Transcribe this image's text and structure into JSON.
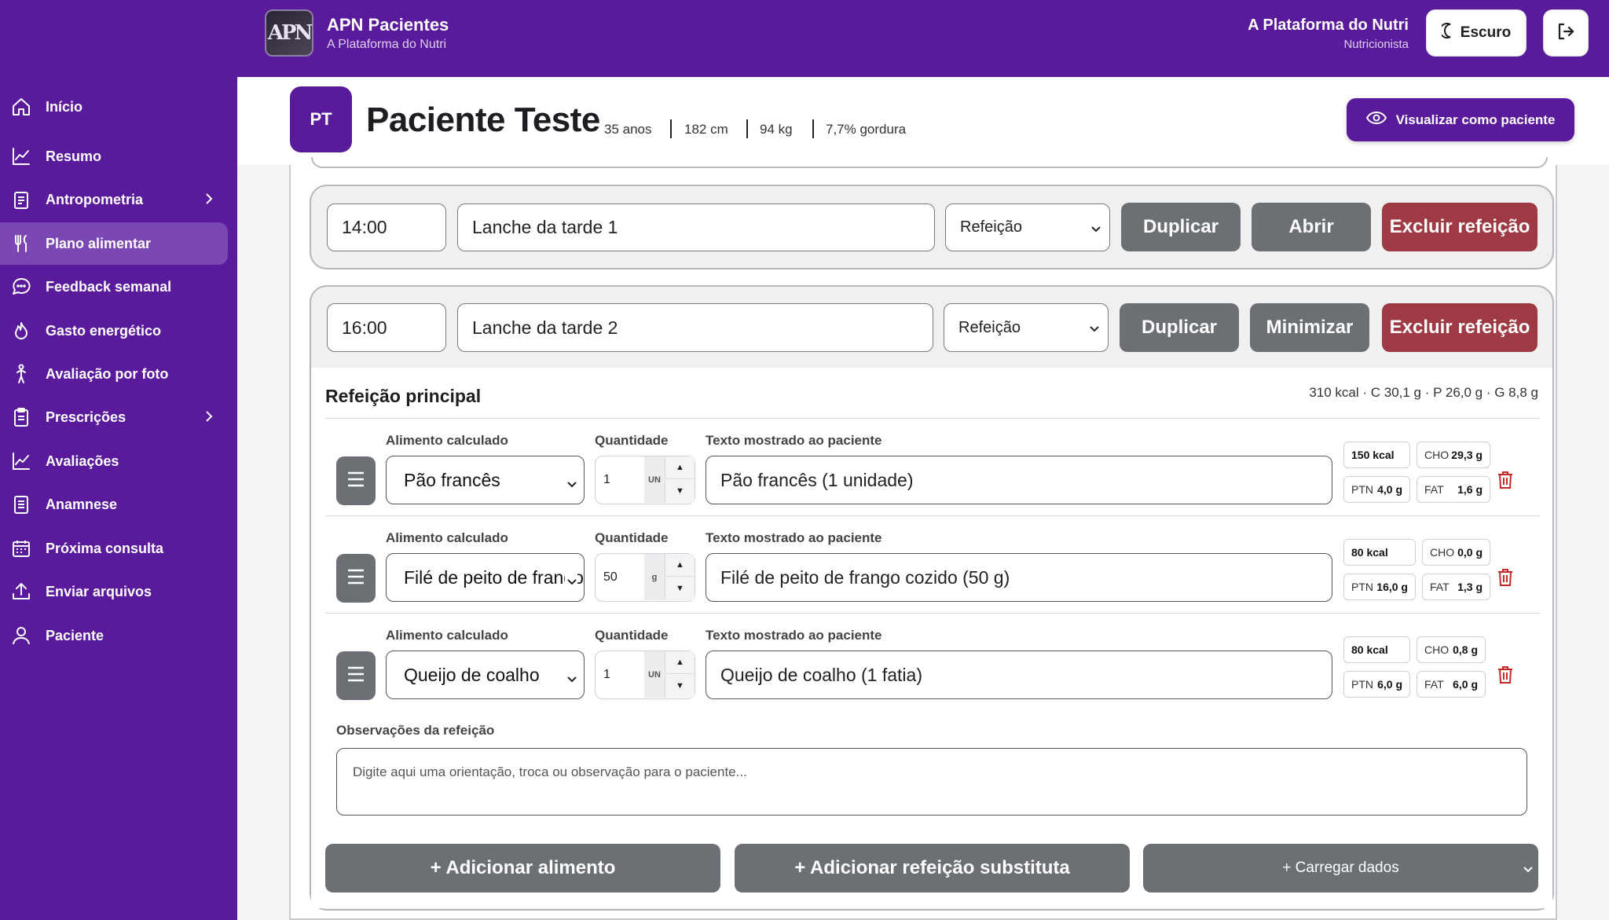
{
  "topbar": {
    "logo_text": "APN",
    "title": "APN Pacientes",
    "subtitle": "A Plataforma do Nutri",
    "user_name": "A Plataforma do Nutri",
    "user_role": "Nutricionista",
    "theme_button": "Escuro"
  },
  "sidebar": {
    "items": [
      {
        "label": "Início",
        "icon": "home-icon"
      },
      {
        "label": "Resumo",
        "icon": "chart-line-icon"
      },
      {
        "label": "Antropometria",
        "icon": "clipboard-icon",
        "has_chevron": true
      },
      {
        "label": "Plano alimentar",
        "icon": "fork-knife-icon",
        "active": true
      },
      {
        "label": "Feedback semanal",
        "icon": "chat-bubble-icon"
      },
      {
        "label": "Gasto energético",
        "icon": "flame-icon"
      },
      {
        "label": "Avaliação por foto",
        "icon": "person-walking-icon"
      },
      {
        "label": "Prescrições",
        "icon": "clipboard-list-icon",
        "has_chevron": true
      },
      {
        "label": "Avaliações",
        "icon": "chart-line-icon"
      },
      {
        "label": "Anamnese",
        "icon": "document-icon"
      },
      {
        "label": "Próxima consulta",
        "icon": "calendar-icon"
      },
      {
        "label": "Enviar arquivos",
        "icon": "upload-icon"
      },
      {
        "label": "Paciente",
        "icon": "user-icon"
      }
    ]
  },
  "patient": {
    "initials": "PT",
    "name": "Paciente Teste",
    "age": "35 anos",
    "height": "182 cm",
    "weight": "94 kg",
    "body_fat": "7,7% gordura",
    "view_button": "Visualizar como paciente"
  },
  "meals": [
    {
      "time": "14:00",
      "name": "Lanche da tarde 1",
      "type": "Refeição",
      "duplicate": "Duplicar",
      "toggle": "Abrir",
      "delete": "Excluir refeição"
    },
    {
      "time": "16:00",
      "name": "Lanche da tarde 2",
      "type": "Refeição",
      "duplicate": "Duplicar",
      "toggle": "Minimizar",
      "delete": "Excluir refeição"
    }
  ],
  "meal_detail": {
    "section_title": "Refeição principal",
    "totals": "310 kcal · C 30,1 g · P 26,0 g · G 8,8 g",
    "labels": {
      "food": "Alimento calculado",
      "quantity": "Quantidade",
      "patient_text": "Texto mostrado ao paciente"
    },
    "foods": [
      {
        "food": "Pão francês",
        "qty": "1",
        "unit": "UN",
        "text": "Pão francês (1 unidade)",
        "kcal": "150 kcal",
        "cho": "29,3 g",
        "ptn": "4,0 g",
        "fat": "1,6 g"
      },
      {
        "food": "Filé de peito de frango cozido",
        "qty": "50",
        "unit": "g",
        "text": "Filé de peito de frango cozido (50 g)",
        "kcal": "80 kcal",
        "cho": "0,0 g",
        "ptn": "16,0 g",
        "fat": "1,3 g"
      },
      {
        "food": "Queijo de coalho",
        "qty": "1",
        "unit": "UN",
        "text": "Queijo de coalho (1 fatia)",
        "kcal": "80 kcal",
        "cho": "0,8 g",
        "ptn": "6,0 g",
        "fat": "6,0 g"
      }
    ],
    "macro_labels": {
      "cho": "CHO",
      "ptn": "PTN",
      "fat": "FAT"
    },
    "obs_label": "Observações da refeição",
    "obs_placeholder": "Digite aqui uma orientação, troca ou observação para o paciente...",
    "add_food": "+ Adicionar alimento",
    "add_substitute": "+ Adicionar refeição substituta",
    "load_data": "+ Carregar dados"
  },
  "colors": {
    "brand_purple": "#5a1a9c",
    "gray_button": "#6c6f74",
    "danger": "#9e3a44"
  }
}
